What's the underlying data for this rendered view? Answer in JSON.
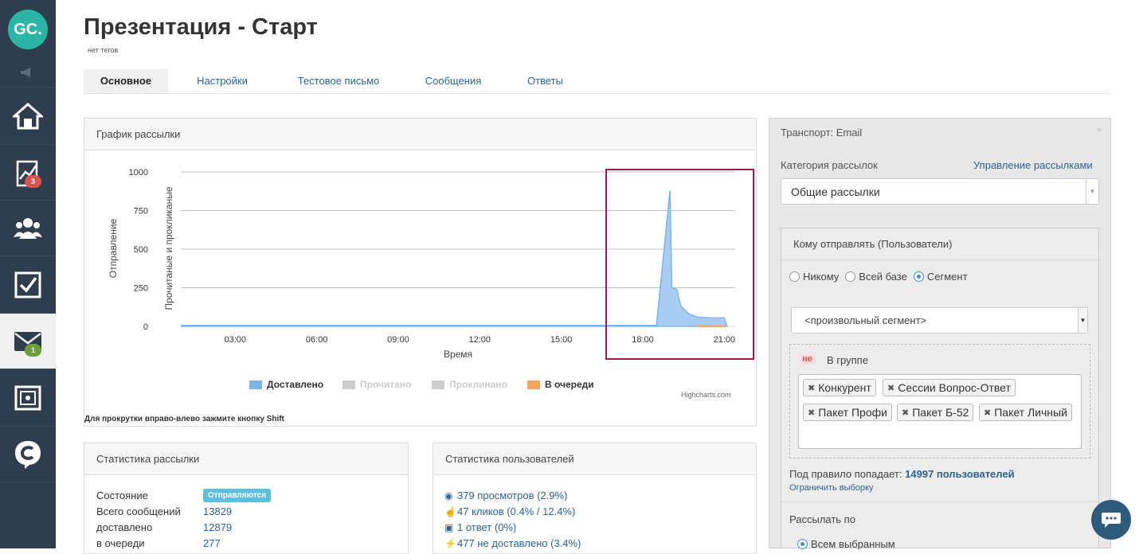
{
  "sidebar": {
    "logo": "GC.",
    "items": [
      {
        "icon": "megaphone-icon"
      },
      {
        "icon": "home-icon"
      },
      {
        "icon": "chart-icon",
        "badge": "3"
      },
      {
        "icon": "users-icon"
      },
      {
        "icon": "checkbox-icon"
      },
      {
        "icon": "mail-icon",
        "badge": "1"
      },
      {
        "icon": "safe-icon"
      },
      {
        "icon": "chat-logo-icon"
      }
    ]
  },
  "header": {
    "title": "Презентация - Старт",
    "tags": "нет тегов"
  },
  "tabs": [
    "Основное",
    "Настройки",
    "Тестовое письмо",
    "Сообщения",
    "Ответы"
  ],
  "chart_panel": {
    "title": "График рассылки",
    "hint": "Для прокрутки вправо-влево зажмите кнопку Shift",
    "credit": "Highcharts.com"
  },
  "chart_data": {
    "type": "area",
    "xlabel": "Время",
    "ylabel_left": "Отправление",
    "ylabel_right": "Прочитаные и прокликаные",
    "ylim": [
      0,
      1000
    ],
    "yticks": [
      "1000",
      "750",
      "500",
      "250",
      "0"
    ],
    "xticks": [
      "03:00",
      "06:00",
      "09:00",
      "12:00",
      "15:00",
      "18:00",
      "21:00"
    ],
    "legend": [
      {
        "name": "Доставлено",
        "color": "#7cb5ec",
        "active": true
      },
      {
        "name": "Прочитано",
        "color": "#cccccc",
        "active": false
      },
      {
        "name": "Проклинано",
        "color": "#cccccc",
        "active": false
      },
      {
        "name": "В очереди",
        "color": "#f7a35c",
        "active": true
      }
    ],
    "series": [
      {
        "name": "Доставлено",
        "points": [
          [
            1,
            0
          ],
          [
            18.5,
            0
          ],
          [
            19.0,
            880
          ],
          [
            19.07,
            250
          ],
          [
            19.25,
            240
          ],
          [
            19.4,
            130
          ],
          [
            19.7,
            80
          ],
          [
            20.0,
            60
          ],
          [
            20.5,
            55
          ],
          [
            21.0,
            55
          ],
          [
            21.1,
            0
          ]
        ]
      },
      {
        "name": "В очереди",
        "points": [
          [
            20.0,
            0
          ],
          [
            20.0,
            4
          ],
          [
            21.0,
            4
          ],
          [
            21.0,
            0
          ]
        ]
      }
    ]
  },
  "transport": {
    "title": "Транспорт: Email",
    "category_label": "Категория рассылок",
    "manage_link": "Управление рассылками",
    "category_value": "Общие рассылки"
  },
  "recipients": {
    "title": "Кому отправлять (Пользователи)",
    "radios": [
      "Никому",
      "Всей базе",
      "Сегмент"
    ],
    "selected": "Сегмент",
    "segment_value": "<произвольный сегмент>",
    "not_badge": "не",
    "group_label": "В группе",
    "chips": [
      "Конкурент",
      "Сессии Вопрос-Ответ",
      "Пакет Профи",
      "Пакет Б-52",
      "Пакет Личный"
    ],
    "rule_text": "Под правило попадает:",
    "rule_count": "14997 пользователей",
    "limit_link": "Ограничить выборку",
    "send_by_label": "Рассылать по",
    "send_by_option": "Всем выбранным"
  },
  "mail_stats": {
    "title": "Статистика рассылки",
    "rows": [
      {
        "label": "Состояние",
        "value": "Отправляются"
      },
      {
        "label": "Всего сообщений",
        "value": "13829"
      },
      {
        "label": "доставлено",
        "value": "12879"
      },
      {
        "label": "в очереди",
        "value": "277"
      }
    ]
  },
  "user_stats": {
    "title": "Статистика пользователей",
    "rows": [
      {
        "icon": "eye-icon",
        "text": "379 просмотров (2.9%)"
      },
      {
        "icon": "hand-pointer-icon",
        "text": "47 кликов (0.4% / 12.4%)"
      },
      {
        "icon": "inbox-icon",
        "text": "1 ответ (0%)"
      },
      {
        "icon": "bolt-icon",
        "text": "477 не доставлено (3.4%)"
      }
    ]
  }
}
